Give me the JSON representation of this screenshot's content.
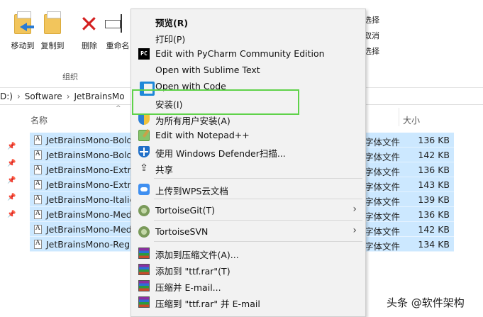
{
  "ribbon": {
    "move_to": "移动到",
    "copy_to": "复制到",
    "delete": "删除",
    "rename": "重命名",
    "group_label": "组织",
    "right_partial": [
      "选择",
      "取消",
      "选择"
    ]
  },
  "address": {
    "drive": "D:)",
    "folder1": "Software",
    "folder2": "JetBrainsMo"
  },
  "columns": {
    "name": "名称",
    "size": "大小"
  },
  "files": [
    {
      "name": "JetBrainsMono-Bold",
      "type": "字体文件",
      "size": "136 KB"
    },
    {
      "name": "JetBrainsMono-Bold",
      "type": "字体文件",
      "size": "142 KB"
    },
    {
      "name": "JetBrainsMono-Extra",
      "type": "字体文件",
      "size": "136 KB"
    },
    {
      "name": "JetBrainsMono-Extra",
      "type": "字体文件",
      "size": "143 KB"
    },
    {
      "name": "JetBrainsMono-Italic",
      "type": "字体文件",
      "size": "139 KB"
    },
    {
      "name": "JetBrainsMono-Med",
      "type": "字体文件",
      "size": "136 KB"
    },
    {
      "name": "JetBrainsMono-Med",
      "type": "字体文件",
      "size": "142 KB"
    },
    {
      "name": "JetBrainsMono-Regu",
      "type": "字体文件",
      "size": "134 KB"
    }
  ],
  "context_menu": {
    "items": [
      {
        "label": "预览(R)",
        "icon": "none"
      },
      {
        "label": "打印(P)",
        "icon": "none"
      },
      {
        "label": "Edit with PyCharm Community Edition",
        "icon": "pycharm-icon"
      },
      {
        "label": "Open with Sublime Text",
        "icon": "none"
      },
      {
        "label": "Open with Code",
        "icon": "vscode-icon"
      },
      {
        "label": "安装(I)",
        "icon": "none"
      },
      {
        "label": "为所有用户安装(A)",
        "icon": "uac-shield-icon"
      },
      {
        "label": "Edit with Notepad++",
        "icon": "notepadpp-icon"
      },
      {
        "label": "使用 Windows Defender扫描...",
        "icon": "defender-icon"
      },
      {
        "label": "共享",
        "icon": "share-icon"
      },
      {
        "label": "上传到WPS云文档",
        "icon": "wps-cloud-icon"
      },
      {
        "label": "TortoiseGit(T)",
        "icon": "tortoisegit-icon"
      },
      {
        "label": "TortoiseSVN",
        "icon": "tortoisesvn-icon"
      },
      {
        "label": "添加到压缩文件(A)...",
        "icon": "winrar-icon"
      },
      {
        "label": "添加到 \"ttf.rar\"(T)",
        "icon": "winrar-icon"
      },
      {
        "label": "压缩并 E-mail...",
        "icon": "winrar-icon"
      },
      {
        "label": "压缩到 \"ttf.rar\" 并 E-mail",
        "icon": "winrar-icon"
      }
    ]
  },
  "watermark": "头条 @软件架构",
  "colors": {
    "selection": "#cce8ff",
    "menu_bg": "#f2f2f2",
    "highlight_box": "#5fd24a"
  }
}
